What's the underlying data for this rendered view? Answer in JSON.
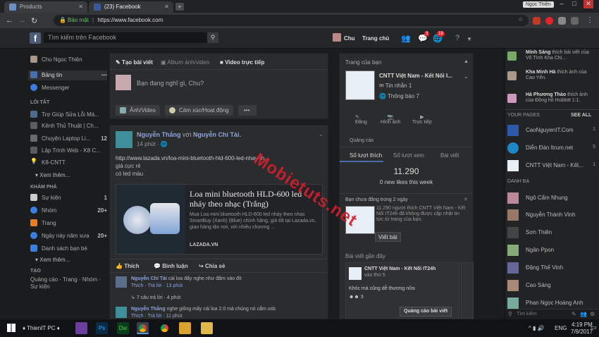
{
  "browser": {
    "tabs": [
      {
        "label": "Products"
      },
      {
        "label": "(23) Facebook"
      }
    ],
    "user_badge": "Ngọc Thiện",
    "secure_label": "Bảo mật",
    "url": "https://www.facebook.com"
  },
  "fb_header": {
    "search_placeholder": "Tìm kiếm trên Facebook",
    "user_name": "Chu",
    "home_label": "Trang chủ",
    "msg_badge": "3",
    "notif_badge": "19"
  },
  "left": {
    "profile": "Chu Ngọc Thiện",
    "news_feed": "Bảng tin",
    "messenger": "Messenger",
    "shortcuts_title": "LỐI TẮT",
    "shortcuts": [
      {
        "label": "Trợ Giúp Sửa Lỗi Má...",
        "count": ""
      },
      {
        "label": "Kênh Thủ Thuật | Ch...",
        "count": ""
      },
      {
        "label": "Chuyện Laptop Li...",
        "count": "12"
      },
      {
        "label": "Lập Trình Web - K8 C...",
        "count": ""
      },
      {
        "label": "K8-CNTT",
        "count": ""
      }
    ],
    "see_more": "Xem thêm...",
    "explore_title": "KHÁM PHÁ",
    "explore": [
      {
        "label": "Sự kiện",
        "count": "1"
      },
      {
        "label": "Nhóm",
        "count": "20+"
      },
      {
        "label": "Trang",
        "count": ""
      },
      {
        "label": "Ngày này năm xưa",
        "count": "20+"
      },
      {
        "label": "Danh sách bạn bè",
        "count": ""
      }
    ],
    "see_more2": "Xem thêm...",
    "create_title": "TẠO",
    "create_links": "Quảng cáo · Trang · Nhóm · Sự kiện"
  },
  "composer": {
    "tab_post": "Tạo bài viết",
    "tab_album": "Album ảnh/video",
    "tab_live": "Video trực tiếp",
    "placeholder": "Bạn đang nghĩ gì, Chu?",
    "photo_btn": "Ảnh/Video",
    "feeling_btn": "Cảm xúc/Hoạt động",
    "more_btn": "•••"
  },
  "post": {
    "author": "Nguyễn Thắng",
    "with_word": "với",
    "with_name": "Nguyễn Chí Tài.",
    "time": "14 phút",
    "link_text": "http://www.lazada.vn/loa-mini-bluetooth-hld-600-led-nhay-th...",
    "line2": "giá cực rẻ",
    "line3": "có led màu",
    "preview_title": "Loa mini bluetooth HLD-600 led nháy theo nhạc (Trắng)",
    "preview_desc": "Mua Loa mini bluetooth HLD-600 led nháy theo nhạc SmartBuy (Xanh) (Blue) chính hãng, giá tốt tại Lazada.vn, giao hàng tận nơi, với nhiều chương ...",
    "preview_domain": "LAZADA.VN",
    "like": "Thích",
    "comment": "Bình luận",
    "share": "Chia sẻ",
    "comment1_name": "Nguyễn Chí Tài",
    "comment1_text": "cái loa đấy nghe như đấm vào đít",
    "comment1_meta": "Thích · Trả lời · 13 phút",
    "reply_count": "7 câu trả lời · 4 phút",
    "comment2_name": "Nguyễn Thắng",
    "comment2_text": "nghe giống mấy cái loa 2.0 mà chúng nó cắm usb",
    "comment2_meta": "Thích · Trả lời · 11 phút"
  },
  "pages_panel": {
    "title": "Trang của bạn",
    "page_name": "CNTT Việt Nam - Kết Nối I...",
    "messages": "Tin nhắn",
    "messages_count": "1",
    "notifications": "Thông báo",
    "notifications_count": "7",
    "publish": "Đăng",
    "photo": "Hình ảnh",
    "live": "Trực tiếp",
    "ads": "Quảng cáo",
    "tab_likes": "Số lượt thích",
    "tab_views": "Số lượt xem",
    "tab_posts": "Bài viết",
    "likes_total": "11.290",
    "likes_week": "0 new likes this week",
    "unpublished_title": "Bạn chưa đăng trong 2 ngày",
    "unpublished_text": "11.290 người thích CNTT Việt Nam - Kết Nối IT24h đã không được cập nhật tin tức từ trang của bạn.",
    "write_post": "Viết bài",
    "recent_title": "Bài viết gần đây",
    "recent_name": "CNTT Việt Nam - Kết Nối IT24h",
    "recent_day": "vào thứ 5",
    "recent_text": "Khóc mà cũng dễ thương nữa",
    "recent_reacts": "3",
    "promote": "Quảng cáo bài viết"
  },
  "chat": {
    "ticker": [
      {
        "name": "Minh Sáng",
        "text": "thích bài viết của Vô Tình Kha Chí..."
      },
      {
        "name": "Kha Minh Hà",
        "text": "thích ảnh của Cao Yến."
      },
      {
        "name": "Hà Phương Thảo",
        "text": "thích ảnh của Đồng hồ Hublott 1:1."
      }
    ],
    "your_pages": "YOUR PAGES",
    "see_all": "SEE ALL",
    "pages": [
      {
        "name": "CaoNguyenIT.Com",
        "count": "1"
      },
      {
        "name": "Diễn Đàn Itrum.net",
        "count": "5"
      },
      {
        "name": "CNTT Việt Nam - Kết...",
        "count": "1"
      }
    ],
    "contacts_title": "DANH BẠ",
    "contacts": [
      "Ngô Cẩm Nhung",
      "Nguyễn Thành Vinh",
      "Sơn Thiên",
      "Ngân Ppon",
      "Đặng Thế Vinh",
      "Cao Sáng",
      "Phan Ngọc Hoàng Anh"
    ],
    "search_placeholder": "Tìm kiếm"
  },
  "watermark": "Mobietuts.net",
  "taskbar": {
    "item": "ThienIT PC",
    "lang": "ENG",
    "time": "4:19 PM",
    "date": "7/9/2017"
  }
}
